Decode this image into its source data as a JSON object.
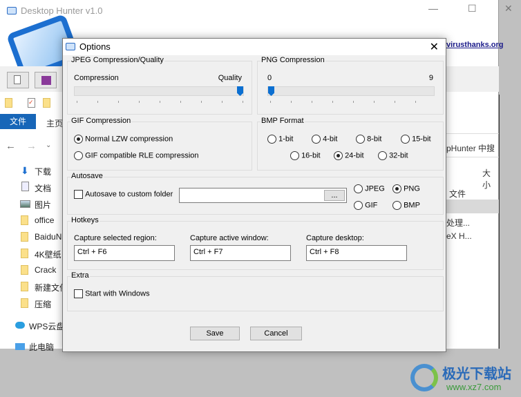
{
  "app": {
    "title": "Desktop Hunter v1.0",
    "minimize": "—",
    "maximize": "☐",
    "close": "✕",
    "website": "virusthanks.org"
  },
  "explorer": {
    "ribbon_tabs": [
      "文件",
      "主页"
    ],
    "sidebar": [
      "下载",
      "文档",
      "图片",
      "office",
      "BaiduN",
      "4K壁纸",
      "Crack",
      "新建文件",
      "压缩",
      "WPS云盘",
      "此电脑"
    ],
    "search_text": "pHunter 中搜",
    "column_size": "大小",
    "type_text": "文件",
    "row1": "处理...",
    "row2": "eX H..."
  },
  "dialog": {
    "title": "Options",
    "close": "✕",
    "jpeg": {
      "legend": "JPEG Compression/Quality",
      "left_label": "Compression",
      "right_label": "Quality",
      "value_percent": 100
    },
    "png": {
      "legend": "PNG Compression",
      "min": "0",
      "max": "9",
      "value": 0
    },
    "gif": {
      "legend": "GIF Compression",
      "options": [
        "Normal LZW compression",
        "GIF compatible RLE compression"
      ],
      "selected": 0
    },
    "bmp": {
      "legend": "BMP Format",
      "options": [
        "1-bit",
        "4-bit",
        "8-bit",
        "15-bit",
        "16-bit",
        "24-bit",
        "32-bit"
      ],
      "selected": "24-bit"
    },
    "autosave": {
      "legend": "Autosave",
      "checkbox_label": "Autosave to custom folder",
      "checked": false,
      "folder_value": "",
      "browse": "...",
      "formats": [
        "JPEG",
        "PNG",
        "GIF",
        "BMP"
      ],
      "selected": "PNG"
    },
    "hotkeys": {
      "legend": "Hotkeys",
      "region_label": "Capture selected region:",
      "region_value": "Ctrl + F6",
      "window_label": "Capture active window:",
      "window_value": "Ctrl + F7",
      "desktop_label": "Capture desktop:",
      "desktop_value": "Ctrl + F8"
    },
    "extra": {
      "legend": "Extra",
      "start_label": "Start with Windows",
      "checked": false
    },
    "save": "Save",
    "cancel": "Cancel"
  },
  "watermark": {
    "name": "极光下载站",
    "url": "www.xz7.com"
  },
  "colors": {
    "accent": "#0b6fd1",
    "ribbon": "#1766b8"
  }
}
